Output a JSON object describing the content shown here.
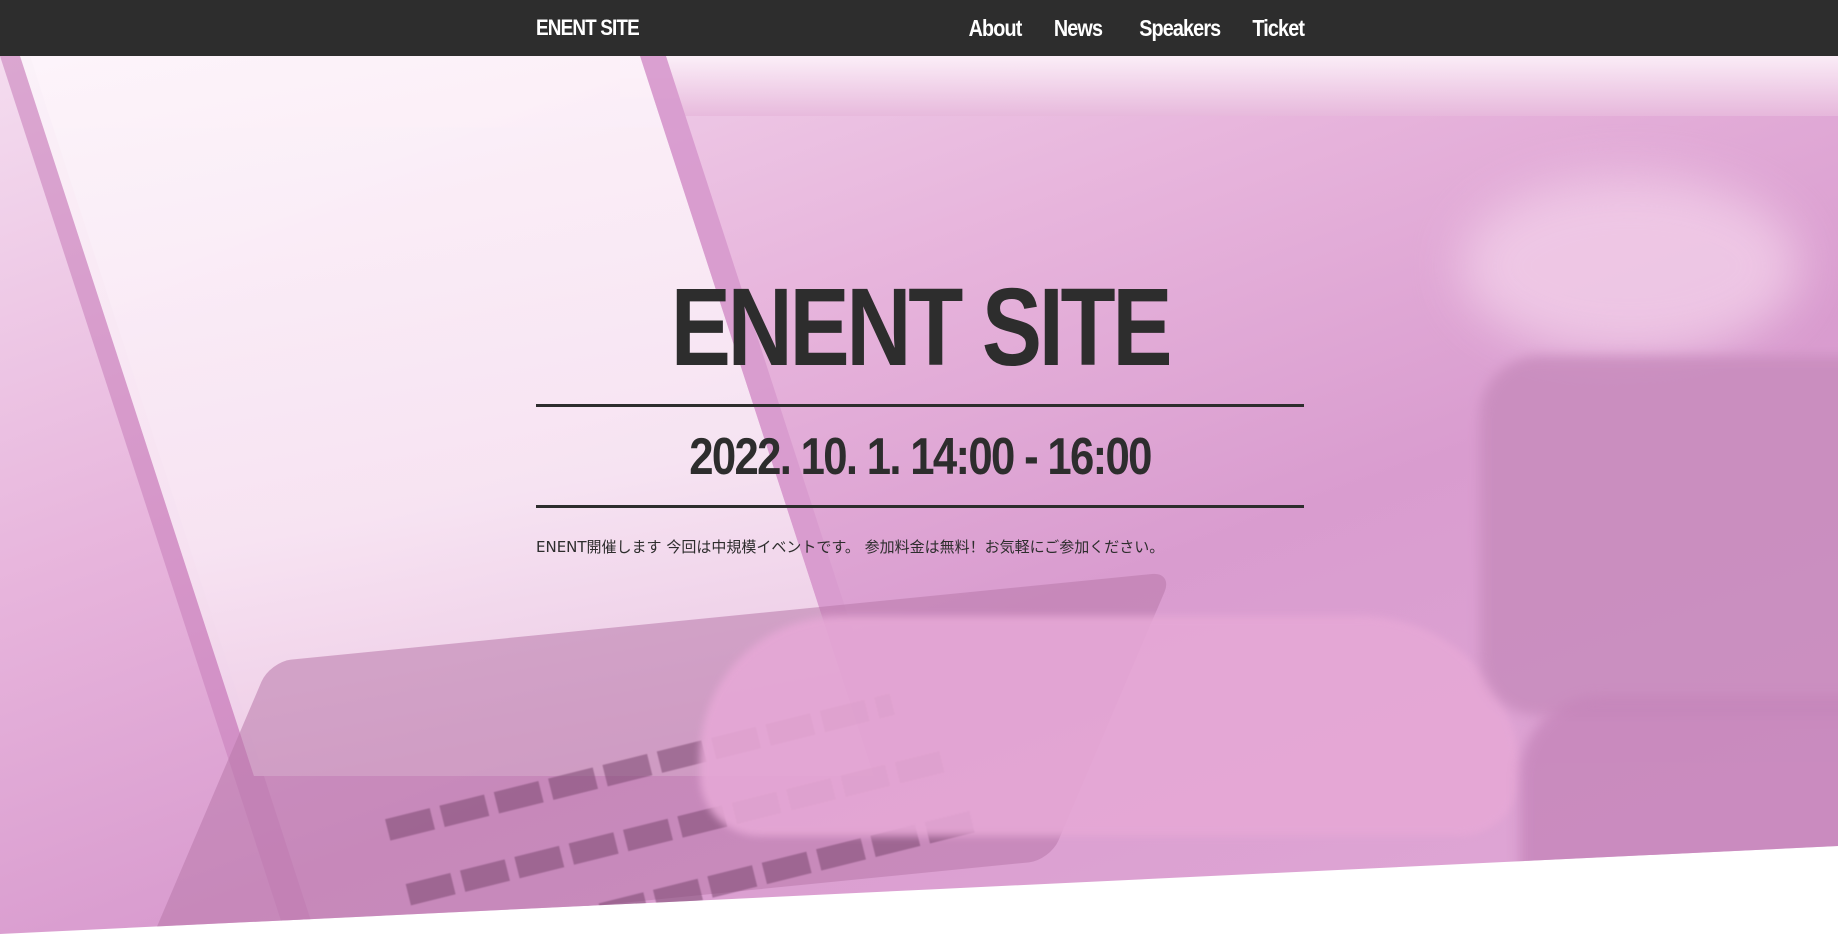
{
  "nav": {
    "brand": "ENENT SITE",
    "links": [
      "About",
      "News",
      "Speakers",
      "Ticket"
    ]
  },
  "hero": {
    "title": "ENENT SITE",
    "date": "2022. 10. 1. 14:00 - 16:00",
    "description": "ENENT開催します 今回は中規模イベントです。 参加料金は無料！お気軽にご参加ください。"
  },
  "colors": {
    "navbar": "#2d2d2d",
    "text_dark": "#2d2d2d",
    "hero_tint": "#e0a8d6"
  }
}
